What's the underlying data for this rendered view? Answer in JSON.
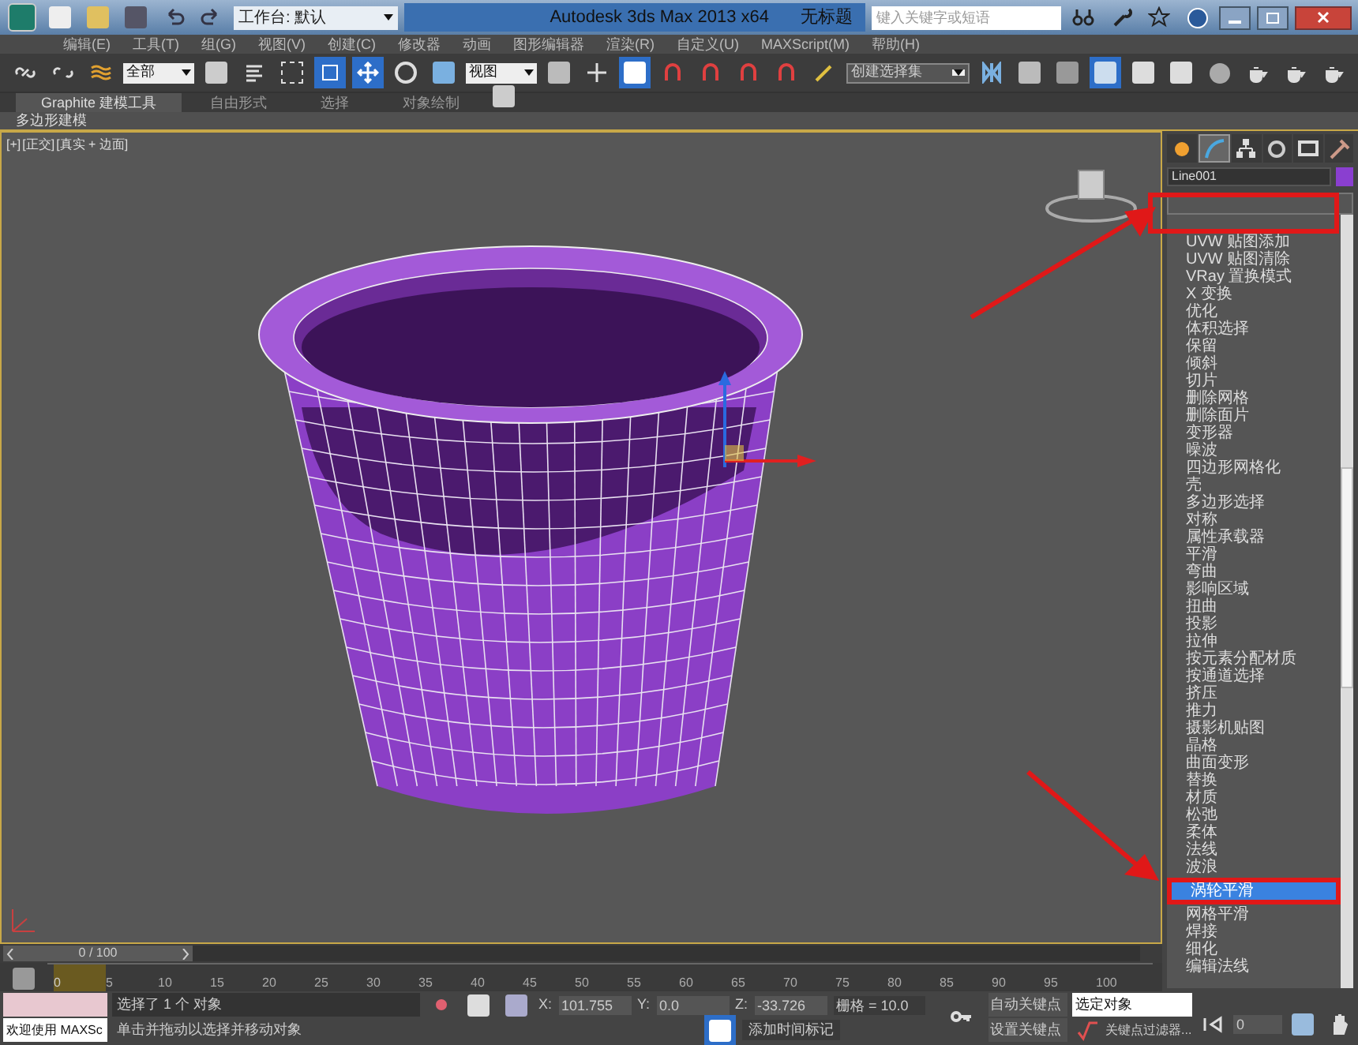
{
  "title_bar": {
    "workspace": "工作台: 默认",
    "title": "Autodesk 3ds Max  2013 x64",
    "document": "无标题",
    "search": {
      "placeholder": "键入关键字或短语"
    }
  },
  "menu": [
    "编辑(E)",
    "工具(T)",
    "组(G)",
    "视图(V)",
    "创建(C)",
    "修改器",
    "动画",
    "图形编辑器",
    "渲染(R)",
    "自定义(U)",
    "MAXScript(M)",
    "帮助(H)"
  ],
  "toolbar": {
    "selection_filter": "全部",
    "coordinate_system": "视图",
    "named_selection": "创建选择集"
  },
  "ribbon": {
    "tabs": [
      {
        "label": "Graphite 建模工具",
        "selected": true
      },
      {
        "label": "自由形式",
        "selected": false
      },
      {
        "label": "选择",
        "selected": false
      },
      {
        "label": "对象绘制",
        "selected": false
      }
    ],
    "panel": "多边形建模"
  },
  "viewport": {
    "labels": [
      "[+]",
      "[正交]",
      "[真实 + 边面]"
    ]
  },
  "command_panel": {
    "tabs": [
      {
        "kind": "create",
        "selected": false
      },
      {
        "kind": "modify",
        "selected": true
      },
      {
        "kind": "hierarchy",
        "selected": false
      },
      {
        "kind": "motion",
        "selected": false
      },
      {
        "kind": "display",
        "selected": false
      },
      {
        "kind": "utilities",
        "selected": false
      }
    ],
    "object_name": "Line001",
    "modifiers": [
      {
        "label": "UVW 贴图添加",
        "selected": false
      },
      {
        "label": "UVW 贴图清除",
        "selected": false
      },
      {
        "label": "VRay 置换模式",
        "selected": false
      },
      {
        "label": "X 变换",
        "selected": false
      },
      {
        "label": "优化",
        "selected": false
      },
      {
        "label": "体积选择",
        "selected": false
      },
      {
        "label": "保留",
        "selected": false
      },
      {
        "label": "倾斜",
        "selected": false
      },
      {
        "label": "切片",
        "selected": false
      },
      {
        "label": "删除网格",
        "selected": false
      },
      {
        "label": "删除面片",
        "selected": false
      },
      {
        "label": "变形器",
        "selected": false
      },
      {
        "label": "噪波",
        "selected": false
      },
      {
        "label": "四边形网格化",
        "selected": false
      },
      {
        "label": "壳",
        "selected": false
      },
      {
        "label": "多边形选择",
        "selected": false
      },
      {
        "label": "对称",
        "selected": false
      },
      {
        "label": "属性承载器",
        "selected": false
      },
      {
        "label": "平滑",
        "selected": false
      },
      {
        "label": "弯曲",
        "selected": false
      },
      {
        "label": "影响区域",
        "selected": false
      },
      {
        "label": "扭曲",
        "selected": false
      },
      {
        "label": "投影",
        "selected": false
      },
      {
        "label": "拉伸",
        "selected": false
      },
      {
        "label": "按元素分配材质",
        "selected": false
      },
      {
        "label": "按通道选择",
        "selected": false
      },
      {
        "label": "挤压",
        "selected": false
      },
      {
        "label": "推力",
        "selected": false
      },
      {
        "label": "摄影机贴图",
        "selected": false
      },
      {
        "label": "晶格",
        "selected": false
      },
      {
        "label": "曲面变形",
        "selected": false
      },
      {
        "label": "替换",
        "selected": false
      },
      {
        "label": "材质",
        "selected": false
      },
      {
        "label": "松弛",
        "selected": false
      },
      {
        "label": "柔体",
        "selected": false
      },
      {
        "label": "法线",
        "selected": false
      },
      {
        "label": "波浪",
        "selected": false
      },
      {
        "label": "涡轮平滑",
        "selected": true
      },
      {
        "label": "网格平滑",
        "selected": false
      },
      {
        "label": "焊接",
        "selected": false
      },
      {
        "label": "细化",
        "selected": false
      },
      {
        "label": "编辑法线",
        "selected": false
      }
    ]
  },
  "timeline": {
    "position": "0 / 100",
    "level": 0,
    "ticks": [
      "0",
      "5",
      "10",
      "15",
      "20",
      "25",
      "30",
      "35",
      "40",
      "45",
      "50",
      "55",
      "60",
      "65",
      "70",
      "75",
      "80",
      "85",
      "90",
      "95",
      "100"
    ]
  },
  "status": {
    "listener": "欢迎使用 MAXSc",
    "selection": "选择了 1 个 对象",
    "prompt": "单击并拖动以选择并移动对象",
    "coords": [
      {
        "axis": "X:",
        "value": "101.755"
      },
      {
        "axis": "Y:",
        "value": "0.0"
      },
      {
        "axis": "Z:",
        "value": "-33.726"
      }
    ],
    "grid": "栅格 = 10.0",
    "add_time_tag": "添加时间标记",
    "auto_key": "自动关键点",
    "set_key": "设置关键点",
    "key_mode": "选定对象",
    "key_filters": "关键点过滤器...",
    "frame": "0"
  }
}
